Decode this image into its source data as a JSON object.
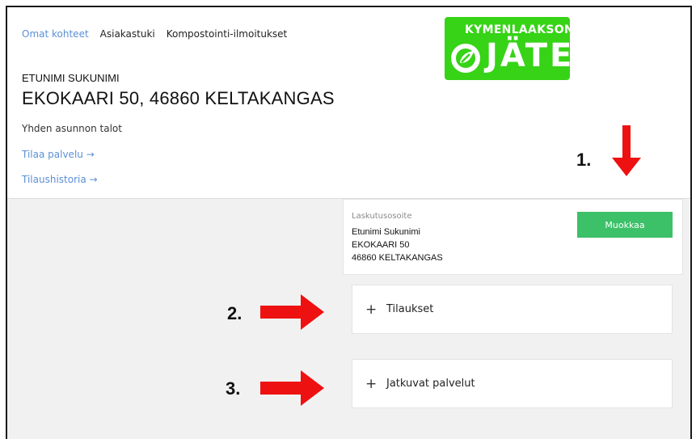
{
  "nav": {
    "items": [
      "Omat kohteet",
      "Asiakastuki",
      "Kompostointi-ilmoitukset"
    ]
  },
  "logo": {
    "top_text": "KYMENLAAKSON",
    "word": "JÄTE",
    "color": "#36d316"
  },
  "customer": {
    "name": "ETUNIMI SUKUNIMI",
    "address": "EKOKAARI 50, 46860 KELTAKANGAS",
    "property_type": "Yhden asunnon talot"
  },
  "links": {
    "order_service": "Tilaa palvelu →",
    "order_history": "Tilaushistoria →"
  },
  "billing": {
    "label": "Laskutusosoite",
    "lines": [
      "Etunimi Sukunimi",
      "EKOKAARI 50",
      "46860 KELTAKANGAS"
    ],
    "edit_label": "Muokkaa",
    "edit_color": "#3cc068"
  },
  "accordions": {
    "orders": {
      "icon": "plus-icon",
      "label": "Tilaukset"
    },
    "continuous": {
      "icon": "plus-icon",
      "label": "Jatkuvat palvelut"
    }
  },
  "annotations": {
    "n1": "1.",
    "n2": "2.",
    "n3": "3.",
    "arrow_color": "#ee1111"
  }
}
